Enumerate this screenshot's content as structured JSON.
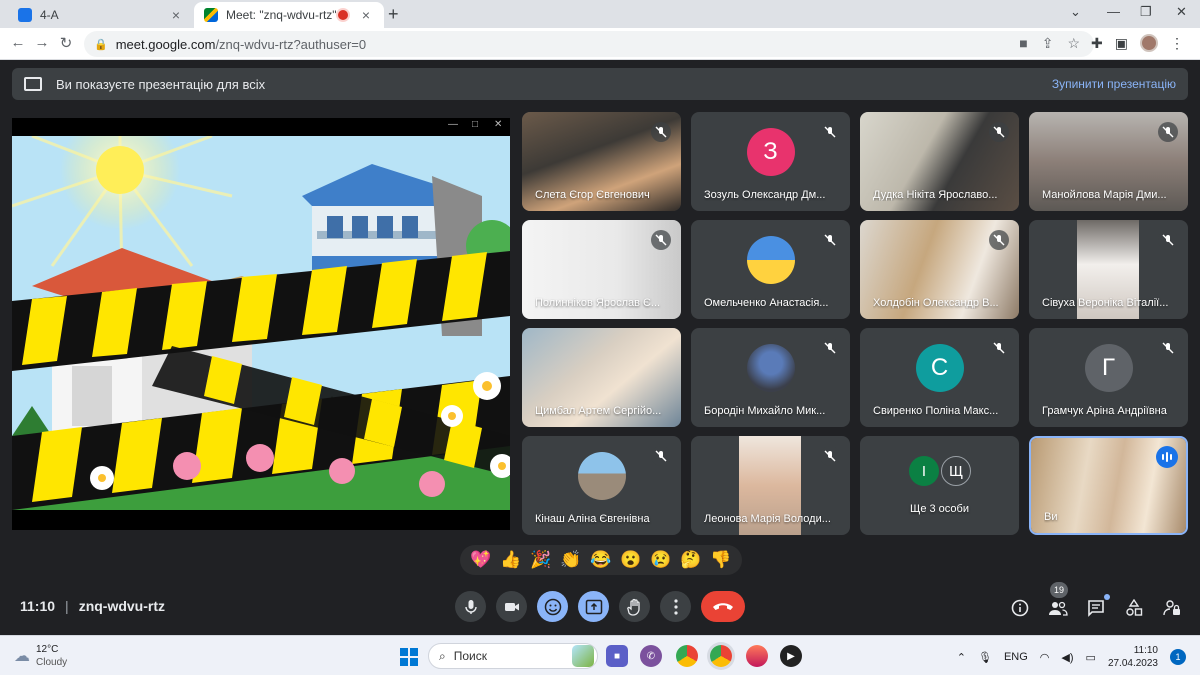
{
  "browser": {
    "tabs": [
      {
        "label": "4-А",
        "close": "×"
      },
      {
        "label": "Meet: \"znq-wdvu-rtz\"",
        "close": "×"
      }
    ],
    "new_tab": "+",
    "url_host": "meet.google.com",
    "url_path": "/znq-wdvu-rtz?authuser=0"
  },
  "meet": {
    "banner_text": "Ви показуєте презентацію для всіх",
    "stop_label": "Зупинити презентацію",
    "participants": [
      {
        "name": "Слета Єгор Євгенович",
        "kind": "video"
      },
      {
        "name": "Зозуль Олександр Дм...",
        "kind": "letter",
        "letter": "З",
        "color": "#e8336d"
      },
      {
        "name": "Дудка Нікіта Ярославо...",
        "kind": "video"
      },
      {
        "name": "Манойлова Марія Дми...",
        "kind": "video"
      },
      {
        "name": "Полинніков Ярослав Є...",
        "kind": "video"
      },
      {
        "name": "Омельченко Анастасія...",
        "kind": "photo"
      },
      {
        "name": "Холдобін Олександр В...",
        "kind": "video"
      },
      {
        "name": "Сівуха Вероніка Віталії...",
        "kind": "video"
      },
      {
        "name": "Цимбал Артем Сергійо...",
        "kind": "video"
      },
      {
        "name": "Бородін Михайло Мик...",
        "kind": "photo"
      },
      {
        "name": "Свиренко Поліна Макс...",
        "kind": "letter",
        "letter": "С",
        "color": "#0f9d9e"
      },
      {
        "name": "Грамчук Аріна Андріївна",
        "kind": "letter",
        "letter": "Г",
        "color": "#5f6368"
      },
      {
        "name": "Кінаш Аліна Євгенівна",
        "kind": "photo"
      },
      {
        "name": "Леонова Марія Володи...",
        "kind": "video"
      },
      {
        "name": "Ще 3 особи",
        "kind": "more",
        "letters": [
          "І",
          "Щ"
        ]
      },
      {
        "name": "Ви",
        "kind": "self"
      }
    ],
    "reactions": [
      "💖",
      "👍",
      "🎉",
      "👏",
      "😂",
      "😮",
      "😢",
      "🤔",
      "👎"
    ],
    "time": "11:10",
    "meeting_code": "znq-wdvu-rtz",
    "participant_count": "19",
    "colors": {
      "accent": "#8ab4f8",
      "end_call": "#ea4335",
      "bg": "#202124"
    }
  },
  "taskbar": {
    "temp": "12°C",
    "weather": "Cloudy",
    "search_placeholder": "Поиск",
    "lang": "ENG",
    "time": "11:10",
    "date": "27.04.2023"
  }
}
